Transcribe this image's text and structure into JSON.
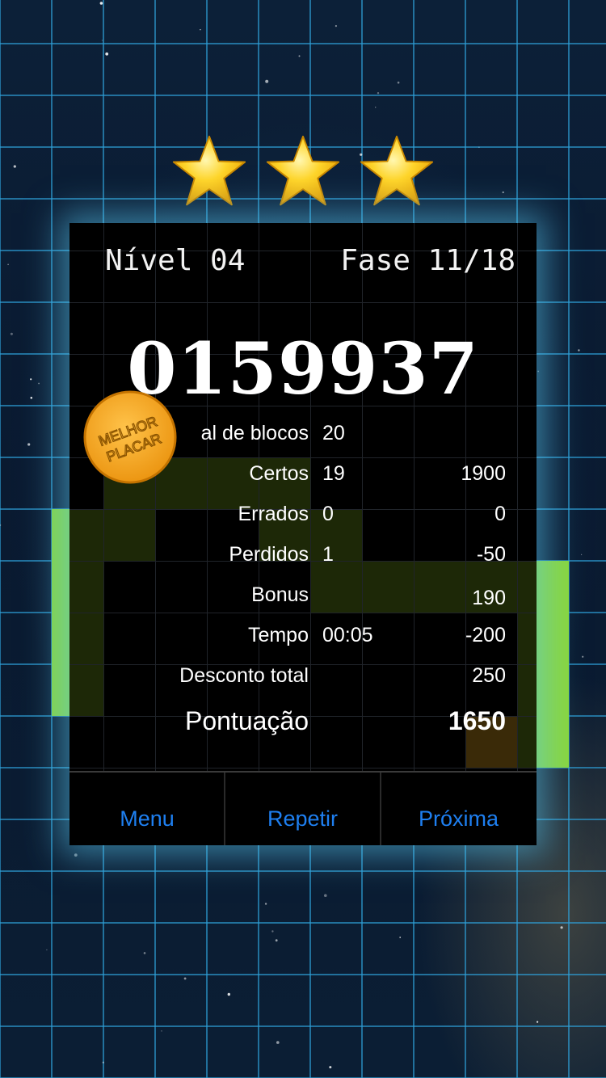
{
  "header": {
    "level": "Nível 04",
    "stage": "Fase 11/18"
  },
  "stars": {
    "earned": 3,
    "total": 3,
    "icon": "star-icon"
  },
  "score": "0159937",
  "badge": {
    "line1": "MELHOR",
    "line2": "PLACAR"
  },
  "stats": [
    {
      "label": "al de blocos",
      "value": "20",
      "points": ""
    },
    {
      "label": "Certos",
      "value": "19",
      "points": "1900"
    },
    {
      "label": "Errados",
      "value": "0",
      "points": "0"
    },
    {
      "label": "Perdidos",
      "value": "1",
      "points": "-50"
    },
    {
      "label": "Bonus",
      "value": "",
      "points": "190"
    },
    {
      "label": "Tempo",
      "value": "00:05",
      "points": "-200"
    },
    {
      "label": "Desconto total",
      "value": "",
      "points": "250"
    }
  ],
  "total": {
    "label": "Pontuação",
    "value": "1650"
  },
  "buttons": {
    "menu": "Menu",
    "retry": "Repetir",
    "next": "Próxima"
  },
  "colors": {
    "button_text": "#1e7ff0",
    "bright_block": "#8ad63a",
    "dim_block": "#1e2a08",
    "orange_block": "#3a2a08",
    "badge": "#f2a31a",
    "glow": "#5ac8f0"
  }
}
